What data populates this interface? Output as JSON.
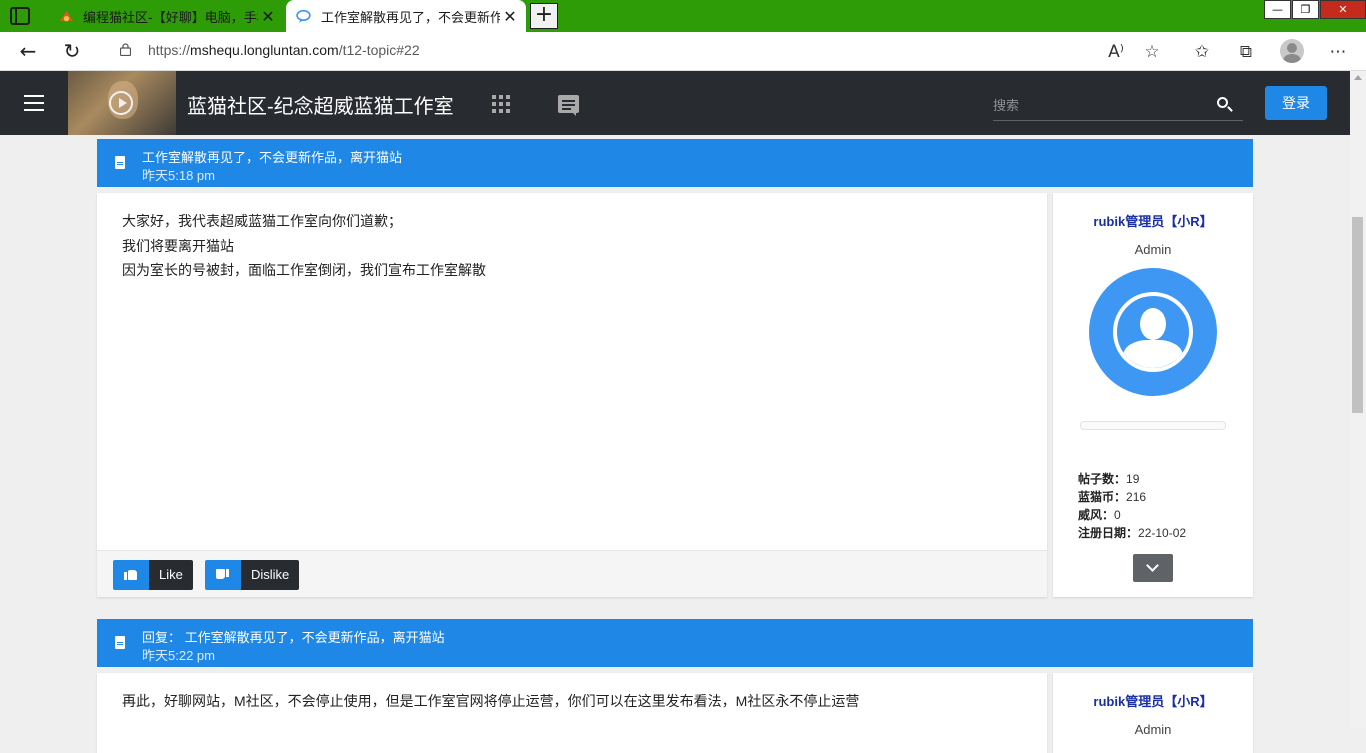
{
  "browser": {
    "tabs": [
      {
        "title": "编程猫社区-【好聊】电脑，手机"
      },
      {
        "title": "工作室解散再见了，不会更新作品"
      }
    ],
    "address": {
      "protocol": "https://",
      "host": "mshequ.longluntan.com",
      "path": "/t12-topic#22"
    }
  },
  "site": {
    "title": "蓝猫社区-纪念超威蓝猫工作室",
    "search_placeholder": "搜索",
    "login_label": "登录"
  },
  "posts": [
    {
      "title": "工作室解散再见了，不会更新作品，离开猫站",
      "time": "昨天5:18 pm",
      "lines": [
        "大家好，我代表超威蓝猫工作室向你们道歉；",
        "我们将要离开猫站",
        "因为室长的号被封，面临工作室倒闭，我们宣布工作室解散"
      ],
      "like_label": "Like",
      "dislike_label": "Dislike",
      "author": {
        "name": "rubik管理员【小R】",
        "role": "Admin",
        "stats": [
          {
            "label": "帖子数：",
            "value": "19"
          },
          {
            "label": "蓝猫币：",
            "value": "216"
          },
          {
            "label": "威风：",
            "value": "0"
          },
          {
            "label": "注册日期：",
            "value": "22-10-02"
          }
        ]
      }
    },
    {
      "title": "回复： 工作室解散再见了，不会更新作品，离开猫站",
      "time": "昨天5:22 pm",
      "lines": [
        "再此，好聊网站，M社区，不会停止使用，但是工作室官网将停止运营，你们可以在这里发布看法，M社区永不停止运营"
      ],
      "author": {
        "name": "rubik管理员【小R】",
        "role": "Admin"
      }
    }
  ]
}
